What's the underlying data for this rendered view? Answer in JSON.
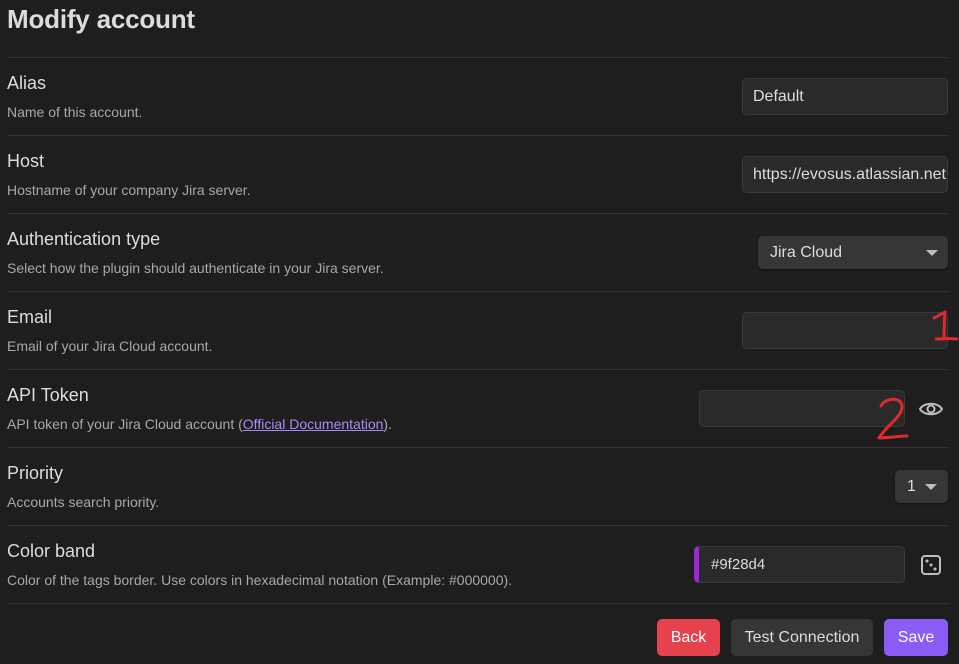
{
  "header": {
    "title": "Modify account"
  },
  "settings": {
    "alias": {
      "name": "Alias",
      "desc": "Name of this account.",
      "value": "Default"
    },
    "host": {
      "name": "Host",
      "desc": "Hostname of your company Jira server.",
      "value": "https://evosus.atlassian.net"
    },
    "auth": {
      "name": "Authentication type",
      "desc": "Select how the plugin should authenticate in your Jira server.",
      "value": "Jira Cloud"
    },
    "email": {
      "name": "Email",
      "desc": "Email of your Jira Cloud account.",
      "value": ""
    },
    "api_token": {
      "name": "API Token",
      "desc_prefix": "API token of your Jira Cloud account (",
      "link": "Official Documentation",
      "desc_suffix": ").",
      "value": ""
    },
    "priority": {
      "name": "Priority",
      "desc": "Accounts search priority.",
      "value": "1"
    },
    "color_band": {
      "name": "Color band",
      "desc": "Color of the tags border. Use colors in hexadecimal notation (Example: #000000).",
      "value": "#9f28d4"
    }
  },
  "buttons": {
    "back": "Back",
    "test": "Test Connection",
    "save": "Save"
  },
  "annotations": {
    "one": "1",
    "two": "2"
  },
  "colors": {
    "background": "#1e1e1e",
    "accent": "#8b5cf6",
    "danger": "#e5424d",
    "color_band": "#9f28d4",
    "annotation": "#e0282d"
  },
  "icons": {
    "reveal": "eye-icon",
    "random_color": "dice-icon",
    "dropdown": "chevron-down-icon"
  }
}
